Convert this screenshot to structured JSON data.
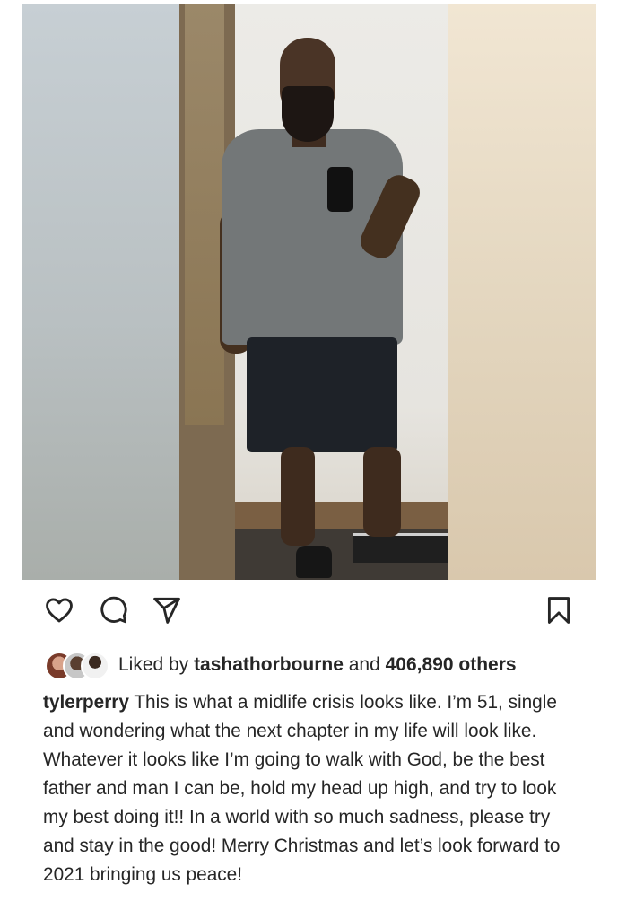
{
  "post": {
    "image_description": "",
    "likes": {
      "prefix": "Liked by ",
      "liker": "tashathorbourne",
      "connector": " and ",
      "others": "406,890 others"
    },
    "caption": {
      "username": "tylerperry",
      "text": " This is what a midlife crisis looks like. I’m 51, single and wondering what the next chapter in my life will look like. Whatever it looks like I’m going to walk with God, be the best father and man I can be, hold my head up high, and try to look my best doing it!! In a world with so much sadness, please try and stay in the good! Merry Christmas and let’s look forward to 2021 bringing us peace!"
    },
    "actions": {
      "like_icon": "heart-icon",
      "comment_icon": "comment-bubble-icon",
      "share_icon": "paper-plane-icon",
      "save_icon": "bookmark-icon"
    }
  }
}
